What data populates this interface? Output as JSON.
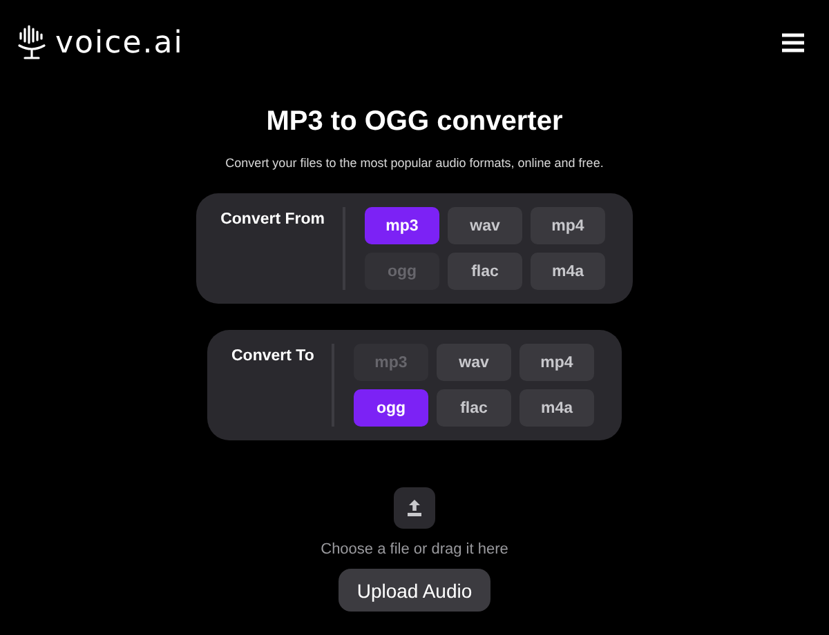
{
  "header": {
    "logo": "voice.ai"
  },
  "title": "MP3 to OGG converter",
  "subtitle": "Convert your files to the most popular audio formats, online and free.",
  "panels": [
    {
      "label": "Convert From",
      "formats": [
        {
          "label": "mp3",
          "selected": true,
          "disabled": false
        },
        {
          "label": "wav",
          "selected": false,
          "disabled": false
        },
        {
          "label": "mp4",
          "selected": false,
          "disabled": false
        },
        {
          "label": "ogg",
          "selected": false,
          "disabled": true
        },
        {
          "label": "flac",
          "selected": false,
          "disabled": false
        },
        {
          "label": "m4a",
          "selected": false,
          "disabled": false
        }
      ]
    },
    {
      "label": "Convert To",
      "formats": [
        {
          "label": "mp3",
          "selected": false,
          "disabled": true
        },
        {
          "label": "wav",
          "selected": false,
          "disabled": false
        },
        {
          "label": "mp4",
          "selected": false,
          "disabled": false
        },
        {
          "label": "ogg",
          "selected": true,
          "disabled": false
        },
        {
          "label": "flac",
          "selected": false,
          "disabled": false
        },
        {
          "label": "m4a",
          "selected": false,
          "disabled": false
        }
      ]
    }
  ],
  "upload": {
    "hint": "Choose a file or drag it here",
    "button": "Upload Audio"
  }
}
